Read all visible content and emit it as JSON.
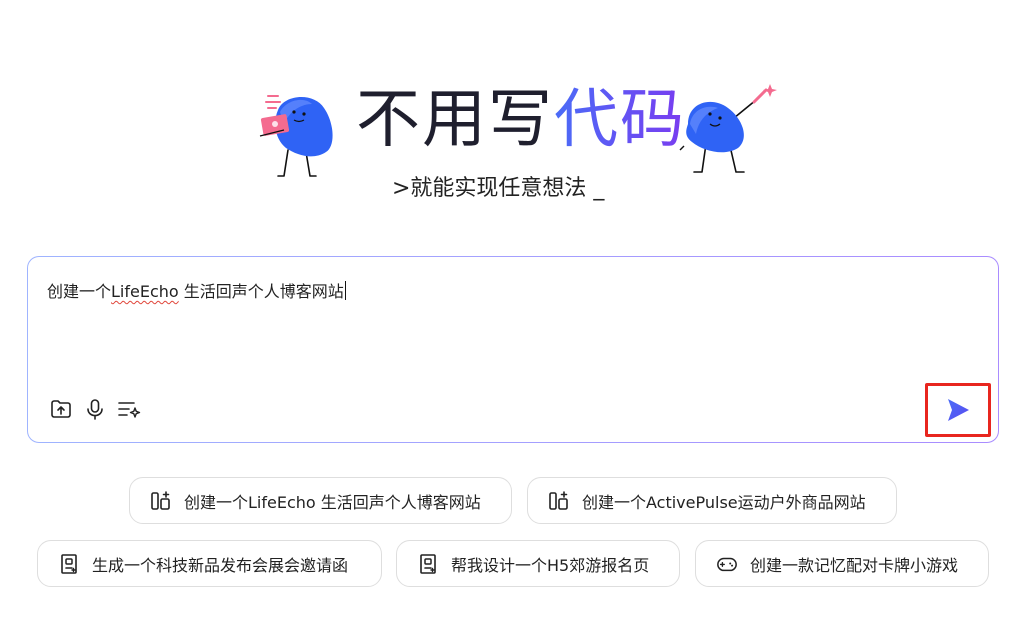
{
  "hero": {
    "title_plain": "不用写",
    "title_accent": "代码",
    "subtitle": ">就能实现任意想法 _"
  },
  "prompt": {
    "text_before": "创建一个",
    "text_squiggle": "LifeEcho",
    "text_after": " 生活回声个人博客网站"
  },
  "toolbar": {
    "upload_icon": "folder-upload-icon",
    "voice_icon": "microphone-icon",
    "optimize_icon": "list-sparkle-icon",
    "send_icon": "send-arrow-icon"
  },
  "suggestions": [
    {
      "label": "创建一个LifeEcho 生活回声个人博客网站",
      "icon": "website-icon"
    },
    {
      "label": "创建一个ActivePulse运动户外商品网站",
      "icon": "website-icon"
    },
    {
      "label": "生成一个科技新品发布会展会邀请函",
      "icon": "document-icon"
    },
    {
      "label": "帮我设计一个H5郊游报名页",
      "icon": "document-icon"
    },
    {
      "label": "创建一款记忆配对卡牌小游戏",
      "icon": "gamepad-icon"
    }
  ],
  "colors": {
    "accent_start": "#4a6cf7",
    "accent_end": "#7a3cf0",
    "highlight_box": "#e8261f"
  }
}
